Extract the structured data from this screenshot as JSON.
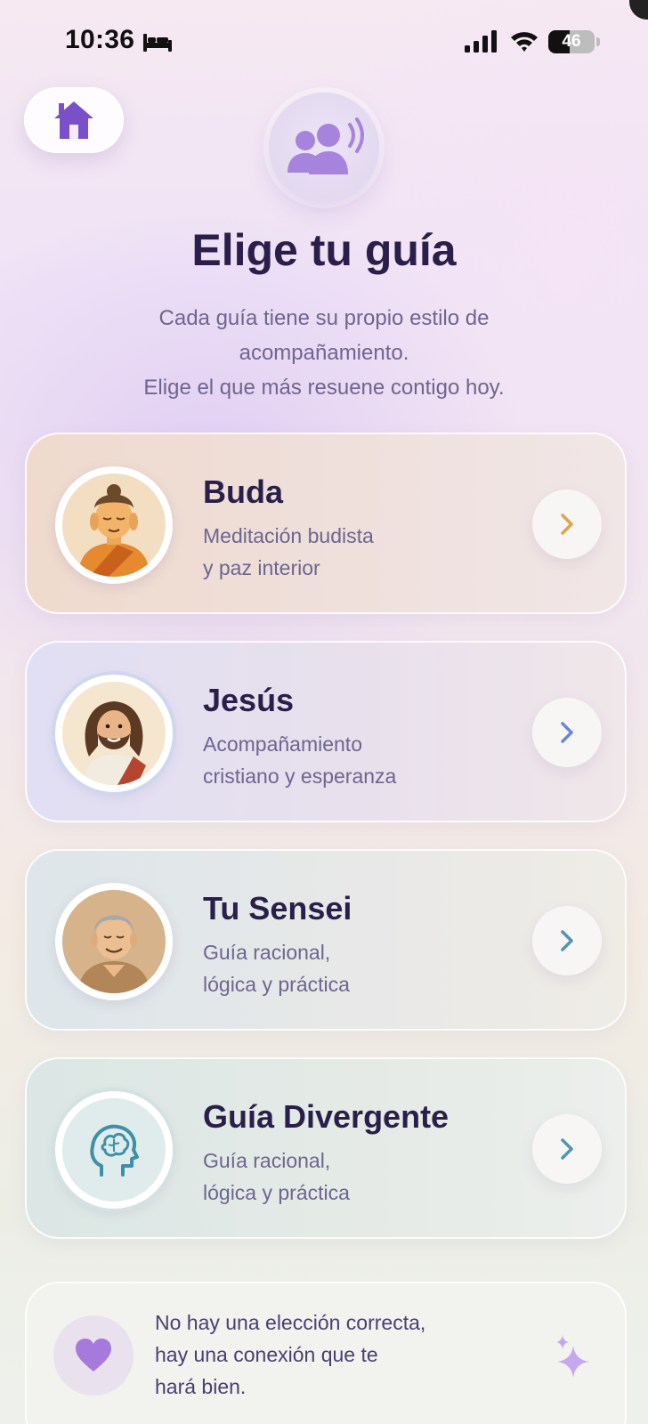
{
  "status_bar": {
    "time": "10:36",
    "battery": "46",
    "battery_level": 0.46,
    "icons": [
      "bed-icon",
      "signal-icon",
      "wifi-icon",
      "battery-icon"
    ]
  },
  "header": {
    "home_icon": "home-icon",
    "hero_icon": "people-voice-icon",
    "title": "Elige tu guía",
    "subtitle_lines": [
      "Cada guía tiene su propio estilo de",
      "acompañamiento.",
      "Elige el que más resuene contigo hoy."
    ]
  },
  "guides": [
    {
      "name": "Buda",
      "desc_lines": [
        "Meditación budista",
        "y paz interior"
      ],
      "avatar_icon": "buddha-avatar",
      "chevron_color": "#e0a14a"
    },
    {
      "name": "Jesús",
      "desc_lines": [
        "Acompañamiento",
        "cristiano y esperanza"
      ],
      "avatar_icon": "jesus-avatar",
      "chevron_color": "#6a86d6"
    },
    {
      "name": "Tu Sensei",
      "desc_lines": [
        "Guía racional,",
        "lógica y práctica"
      ],
      "avatar_icon": "sensei-avatar",
      "chevron_color": "#4f97ad"
    },
    {
      "name": "Guía Divergente",
      "desc_lines": [
        "Guía racional,",
        "lógica y práctica"
      ],
      "avatar_icon": "brain-head-icon",
      "chevron_color": "#4f97ad"
    }
  ],
  "footer": {
    "icon": "heart-icon",
    "lines": [
      "No hay una elección correcta,",
      "hay una conexión que te",
      "hará bien."
    ],
    "sparkle_icon": "sparkle-icon"
  },
  "colors": {
    "accent_purple": "#7b4fc9",
    "title": "#2a1f4a",
    "body": "#6e6590"
  }
}
